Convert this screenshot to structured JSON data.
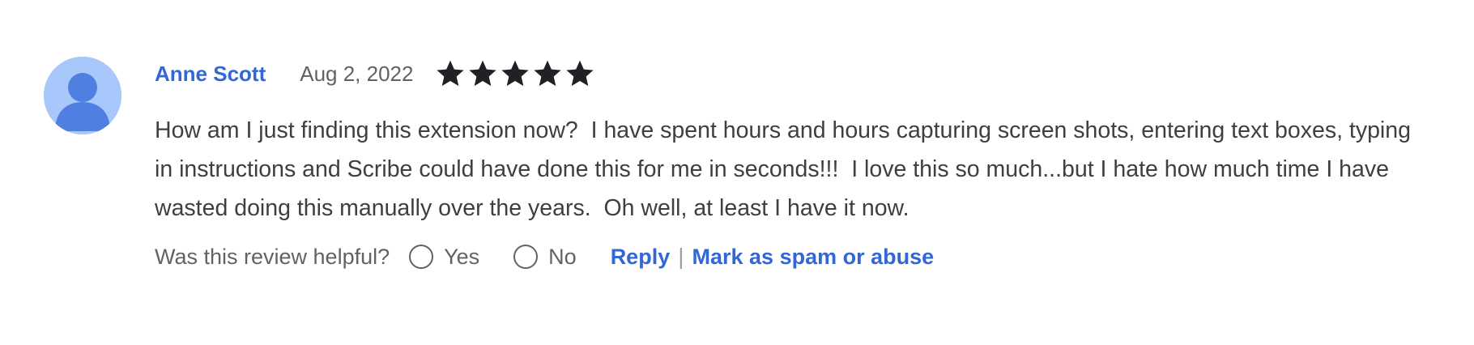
{
  "review": {
    "author": "Anne Scott",
    "date": "Aug 2, 2022",
    "rating": 5,
    "rating_max": 5,
    "body": "How am I just finding this extension now?  I have spent hours and hours capturing screen shots, entering text boxes, typing in instructions and Scribe could have done this for me in seconds!!!  I love this so much...but I hate how much time I have wasted doing this manually over the years.  Oh well, at least I have it now."
  },
  "footer": {
    "helpful_question": "Was this review helpful?",
    "yes_label": "Yes",
    "no_label": "No",
    "reply_label": "Reply",
    "separator": "|",
    "spam_label": "Mark as spam or abuse"
  },
  "icons": {
    "avatar": "default-user-avatar-icon",
    "star": "star-filled-icon"
  },
  "colors": {
    "link": "#3367d6",
    "avatar_bg": "#a8c7fa",
    "avatar_figure": "#4f7fe0",
    "star": "#202124"
  }
}
